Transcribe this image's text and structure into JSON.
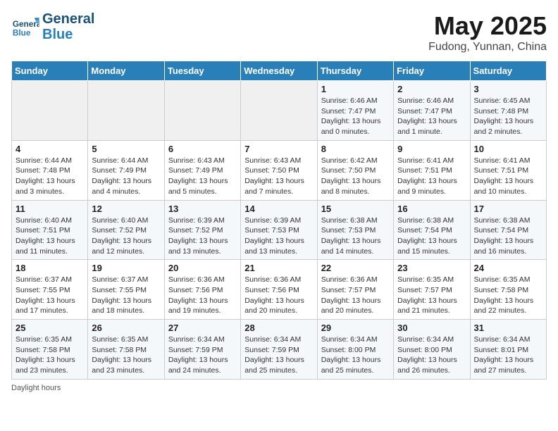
{
  "header": {
    "logo_line1": "General",
    "logo_line2": "Blue",
    "title": "May 2025",
    "subtitle": "Fudong, Yunnan, China"
  },
  "calendar": {
    "days_of_week": [
      "Sunday",
      "Monday",
      "Tuesday",
      "Wednesday",
      "Thursday",
      "Friday",
      "Saturday"
    ],
    "weeks": [
      [
        {
          "num": "",
          "info": ""
        },
        {
          "num": "",
          "info": ""
        },
        {
          "num": "",
          "info": ""
        },
        {
          "num": "",
          "info": ""
        },
        {
          "num": "1",
          "info": "Sunrise: 6:46 AM\nSunset: 7:47 PM\nDaylight: 13 hours and 0 minutes."
        },
        {
          "num": "2",
          "info": "Sunrise: 6:46 AM\nSunset: 7:47 PM\nDaylight: 13 hours and 1 minute."
        },
        {
          "num": "3",
          "info": "Sunrise: 6:45 AM\nSunset: 7:48 PM\nDaylight: 13 hours and 2 minutes."
        }
      ],
      [
        {
          "num": "4",
          "info": "Sunrise: 6:44 AM\nSunset: 7:48 PM\nDaylight: 13 hours and 3 minutes."
        },
        {
          "num": "5",
          "info": "Sunrise: 6:44 AM\nSunset: 7:49 PM\nDaylight: 13 hours and 4 minutes."
        },
        {
          "num": "6",
          "info": "Sunrise: 6:43 AM\nSunset: 7:49 PM\nDaylight: 13 hours and 5 minutes."
        },
        {
          "num": "7",
          "info": "Sunrise: 6:43 AM\nSunset: 7:50 PM\nDaylight: 13 hours and 7 minutes."
        },
        {
          "num": "8",
          "info": "Sunrise: 6:42 AM\nSunset: 7:50 PM\nDaylight: 13 hours and 8 minutes."
        },
        {
          "num": "9",
          "info": "Sunrise: 6:41 AM\nSunset: 7:51 PM\nDaylight: 13 hours and 9 minutes."
        },
        {
          "num": "10",
          "info": "Sunrise: 6:41 AM\nSunset: 7:51 PM\nDaylight: 13 hours and 10 minutes."
        }
      ],
      [
        {
          "num": "11",
          "info": "Sunrise: 6:40 AM\nSunset: 7:51 PM\nDaylight: 13 hours and 11 minutes."
        },
        {
          "num": "12",
          "info": "Sunrise: 6:40 AM\nSunset: 7:52 PM\nDaylight: 13 hours and 12 minutes."
        },
        {
          "num": "13",
          "info": "Sunrise: 6:39 AM\nSunset: 7:52 PM\nDaylight: 13 hours and 13 minutes."
        },
        {
          "num": "14",
          "info": "Sunrise: 6:39 AM\nSunset: 7:53 PM\nDaylight: 13 hours and 13 minutes."
        },
        {
          "num": "15",
          "info": "Sunrise: 6:38 AM\nSunset: 7:53 PM\nDaylight: 13 hours and 14 minutes."
        },
        {
          "num": "16",
          "info": "Sunrise: 6:38 AM\nSunset: 7:54 PM\nDaylight: 13 hours and 15 minutes."
        },
        {
          "num": "17",
          "info": "Sunrise: 6:38 AM\nSunset: 7:54 PM\nDaylight: 13 hours and 16 minutes."
        }
      ],
      [
        {
          "num": "18",
          "info": "Sunrise: 6:37 AM\nSunset: 7:55 PM\nDaylight: 13 hours and 17 minutes."
        },
        {
          "num": "19",
          "info": "Sunrise: 6:37 AM\nSunset: 7:55 PM\nDaylight: 13 hours and 18 minutes."
        },
        {
          "num": "20",
          "info": "Sunrise: 6:36 AM\nSunset: 7:56 PM\nDaylight: 13 hours and 19 minutes."
        },
        {
          "num": "21",
          "info": "Sunrise: 6:36 AM\nSunset: 7:56 PM\nDaylight: 13 hours and 20 minutes."
        },
        {
          "num": "22",
          "info": "Sunrise: 6:36 AM\nSunset: 7:57 PM\nDaylight: 13 hours and 20 minutes."
        },
        {
          "num": "23",
          "info": "Sunrise: 6:35 AM\nSunset: 7:57 PM\nDaylight: 13 hours and 21 minutes."
        },
        {
          "num": "24",
          "info": "Sunrise: 6:35 AM\nSunset: 7:58 PM\nDaylight: 13 hours and 22 minutes."
        }
      ],
      [
        {
          "num": "25",
          "info": "Sunrise: 6:35 AM\nSunset: 7:58 PM\nDaylight: 13 hours and 23 minutes."
        },
        {
          "num": "26",
          "info": "Sunrise: 6:35 AM\nSunset: 7:58 PM\nDaylight: 13 hours and 23 minutes."
        },
        {
          "num": "27",
          "info": "Sunrise: 6:34 AM\nSunset: 7:59 PM\nDaylight: 13 hours and 24 minutes."
        },
        {
          "num": "28",
          "info": "Sunrise: 6:34 AM\nSunset: 7:59 PM\nDaylight: 13 hours and 25 minutes."
        },
        {
          "num": "29",
          "info": "Sunrise: 6:34 AM\nSunset: 8:00 PM\nDaylight: 13 hours and 25 minutes."
        },
        {
          "num": "30",
          "info": "Sunrise: 6:34 AM\nSunset: 8:00 PM\nDaylight: 13 hours and 26 minutes."
        },
        {
          "num": "31",
          "info": "Sunrise: 6:34 AM\nSunset: 8:01 PM\nDaylight: 13 hours and 27 minutes."
        }
      ]
    ]
  },
  "footer": {
    "note": "Daylight hours"
  }
}
